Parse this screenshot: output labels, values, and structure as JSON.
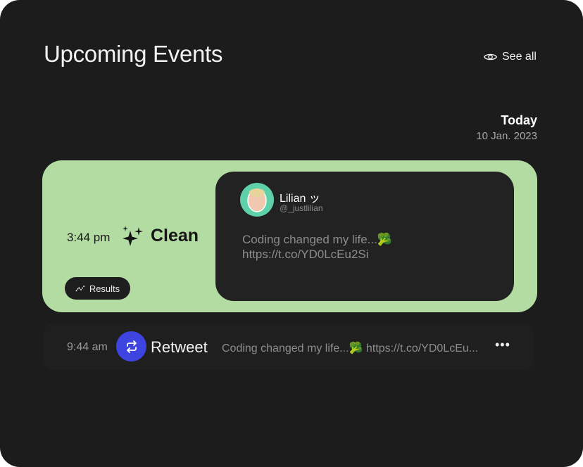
{
  "header": {
    "title": "Upcoming Events",
    "see_all": "See all"
  },
  "date": {
    "label": "Today",
    "value": "10 Jan. 2023"
  },
  "featured": {
    "time": "3:44 pm",
    "event": "Clean",
    "results_label": "Results",
    "accent": "#b3dca2",
    "tweet": {
      "name": "Lilian ッ",
      "handle": "@_justlilian",
      "text_line1": "Coding changed my life...🥦",
      "text_line2": "https://t.co/YD0LcEu2Si"
    }
  },
  "row": {
    "time": "9:44 am",
    "event": "Retweet",
    "text": "Coding changed my life...🥦 https://t.co/YD0LcEu...",
    "more": "•••",
    "accent": "#3d44e0"
  }
}
